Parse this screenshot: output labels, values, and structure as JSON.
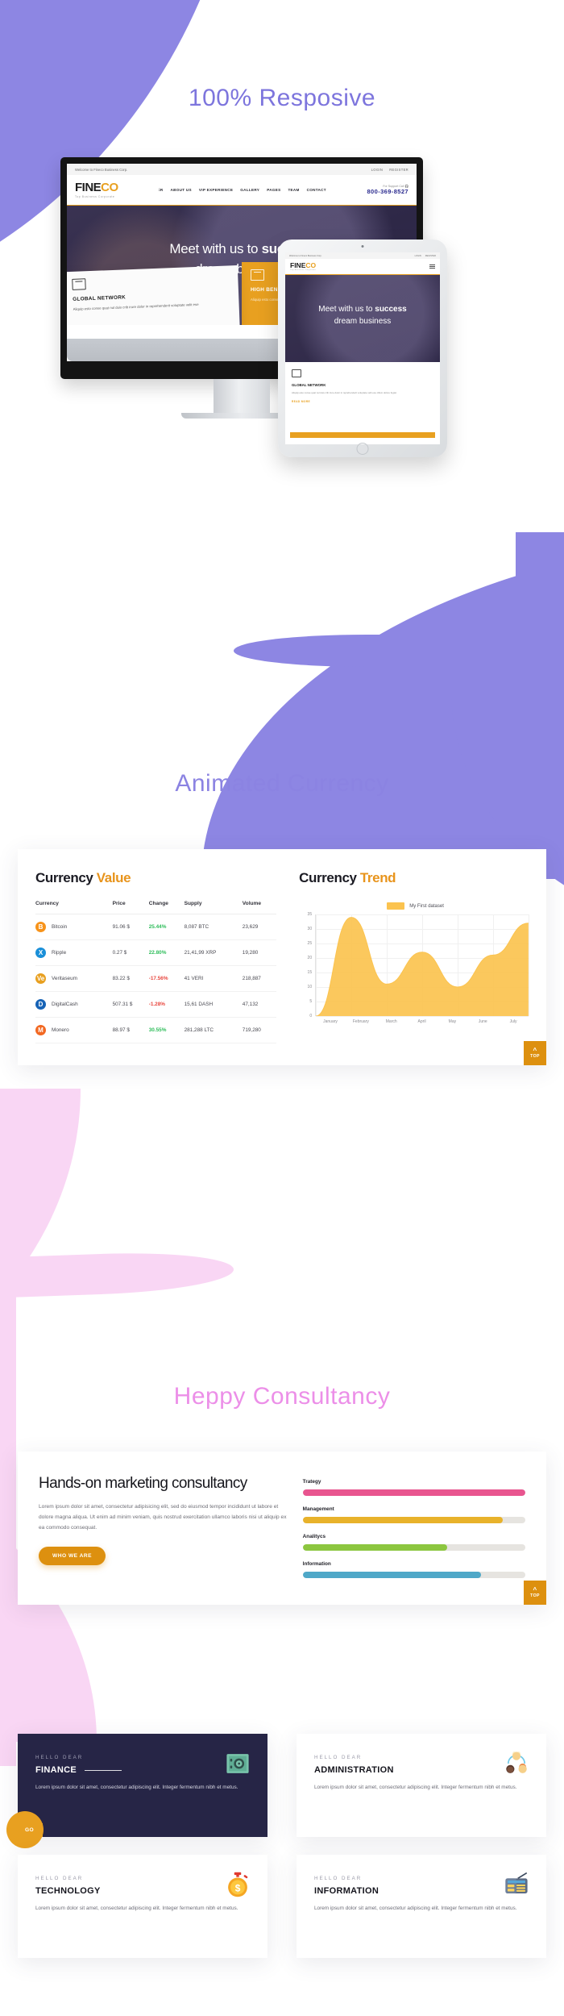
{
  "sections": {
    "responsive_title": "100% Resposive",
    "currency_title": "Animated Currency",
    "consultancy_title": "Heppy Consultancy"
  },
  "colors": {
    "purple": "#8d86e3",
    "pink": "#f9d6f4",
    "orange": "#e8a020",
    "dark_navy": "#262546",
    "green": "#2fbd5b",
    "red": "#e8473f"
  },
  "mockup": {
    "topbar_welcome": "Welcome to Fineco Business Corp.",
    "topbar_links": [
      "LOGIN",
      "REGISTER"
    ],
    "logo_fine": "FINE",
    "logo_co": "CO",
    "logo_tagline": "Top Business Corporate",
    "nav": [
      "iR",
      "ABOUT US",
      "VIP EXPERIENCE",
      "GALLERY",
      "PAGES",
      "TEAM",
      "CONTACT"
    ],
    "support_label": "For Support Call",
    "support_number": "800-369-8527",
    "hero_line1_plain": "Meet with us to ",
    "hero_line1_bold": "success",
    "hero_line2": "dream business",
    "cards": [
      {
        "title": "GLOBAL NETWORK",
        "text": "Aliquip esto conse quat nul duis crib irure dolor in reprehenderit voluptate velit ese"
      },
      {
        "title": "HIGH BENEFITS",
        "text": "Aliquip esto conse quat nul duis crib irure dolor in reprehenderit voluptate velit ese"
      }
    ],
    "tablet": {
      "body_title": "GLOBAL NETWORK",
      "body_text": "Aliquip esto conse quat nul duis crib irure dolor in reprehenderit voluptate velit ese cillum dolore fugiat.",
      "read_more": "READ MORE"
    }
  },
  "currency_value": {
    "title_plain": "Currency ",
    "title_accent": "Value",
    "columns": [
      "Currency",
      "Price",
      "Change",
      "Supply",
      "Volume"
    ],
    "rows": [
      {
        "name": "Bitcoin",
        "symbol": "B",
        "color": "#f7931a",
        "price": "91.06 $",
        "change": "25.44%",
        "positive": true,
        "supply": "8,087 BTC",
        "volume": "23,629"
      },
      {
        "name": "Ripple",
        "symbol": "X",
        "color": "#1a8fd8",
        "price": "0.27 $",
        "change": "22.80%",
        "positive": true,
        "supply": "21,41,99 XRP",
        "volume": "19,280"
      },
      {
        "name": "Veritaseum",
        "symbol": "Ve",
        "color": "#e8a020",
        "price": "83.22 $",
        "change": "-17.56%",
        "positive": false,
        "supply": "41 VERI",
        "volume": "218,887"
      },
      {
        "name": "DigitalCash",
        "symbol": "D",
        "color": "#1763b6",
        "price": "507.31 $",
        "change": "-1.28%",
        "positive": false,
        "supply": "15,61 DASH",
        "volume": "47,132"
      },
      {
        "name": "Monero",
        "symbol": "M",
        "color": "#f26822",
        "price": "88.97 $",
        "change": "30.55%",
        "positive": true,
        "supply": "281,288 LTC",
        "volume": "719,280"
      }
    ]
  },
  "chart_data": {
    "type": "area",
    "title_plain": "Currency ",
    "title_accent": "Trend",
    "legend": [
      "My First dataset"
    ],
    "legend_position": "top-center",
    "categories": [
      "January",
      "February",
      "March",
      "April",
      "May",
      "June",
      "July"
    ],
    "series": [
      {
        "name": "My First dataset",
        "values": [
          0,
          34,
          11,
          22,
          10,
          21,
          32
        ],
        "color": "#fbc34f"
      }
    ],
    "yticks": [
      0,
      5,
      10,
      15,
      20,
      25,
      30,
      35
    ],
    "ylim": [
      0,
      35
    ],
    "xlabel": "",
    "ylabel": "",
    "grid": true
  },
  "top_button": {
    "label": "TOP",
    "icon": "chevron-up-icon"
  },
  "consultancy": {
    "heading": "Hands-on marketing consultancy",
    "paragraph": "Lorem ipsum dolor sit amet, consectetur adipisicing elit, sed do eiusmod tempor incididunt ut labore et dolore magna aliqua. Ut enim ad minim veniam, quis nostrud exercitation ullamco laboris nisi ut aliquip ex ea commodo consequat.",
    "button": "WHO WE ARE",
    "skills": [
      {
        "label": "Trategy",
        "percent": 100,
        "color": "#e8558f"
      },
      {
        "label": "Management",
        "percent": 90,
        "color": "#e8b22b"
      },
      {
        "label": "Analitycs",
        "percent": 65,
        "color": "#8cc63f"
      },
      {
        "label": "Information",
        "percent": 80,
        "color": "#4fa8c8"
      }
    ]
  },
  "features": [
    {
      "eyebrow": "HELLO DEAR",
      "title": "FINANCE",
      "text": "Lorem ipsum dolor sit amet, consectetur adipiscing elit. Integer fermentum nibh et metus.",
      "icon": "safe-vault-icon",
      "theme": "dark",
      "go_label": "GO",
      "has_rule": true
    },
    {
      "eyebrow": "HELLO DEAR",
      "title": "ADMINISTRATION",
      "text": "Lorem ipsum dolor sit amet, consectetur adipiscing elit. Integer fermentum nibh et metus.",
      "icon": "team-people-icon",
      "theme": "light",
      "go_label": "",
      "has_rule": false
    },
    {
      "eyebrow": "HELLO DEAR",
      "title": "TECHNOLOGY",
      "text": "Lorem ipsum dolor sit amet, consectetur adipiscing elit. Integer fermentum nibh et metus.",
      "icon": "stopwatch-dollar-icon",
      "theme": "light",
      "go_label": "",
      "has_rule": false
    },
    {
      "eyebrow": "HELLO DEAR",
      "title": "INFORMATION",
      "text": "Lorem ipsum dolor sit amet, consectetur adipiscing elit. Integer fermentum nibh et metus.",
      "icon": "radio-news-icon",
      "theme": "light",
      "go_label": "",
      "has_rule": false
    }
  ]
}
